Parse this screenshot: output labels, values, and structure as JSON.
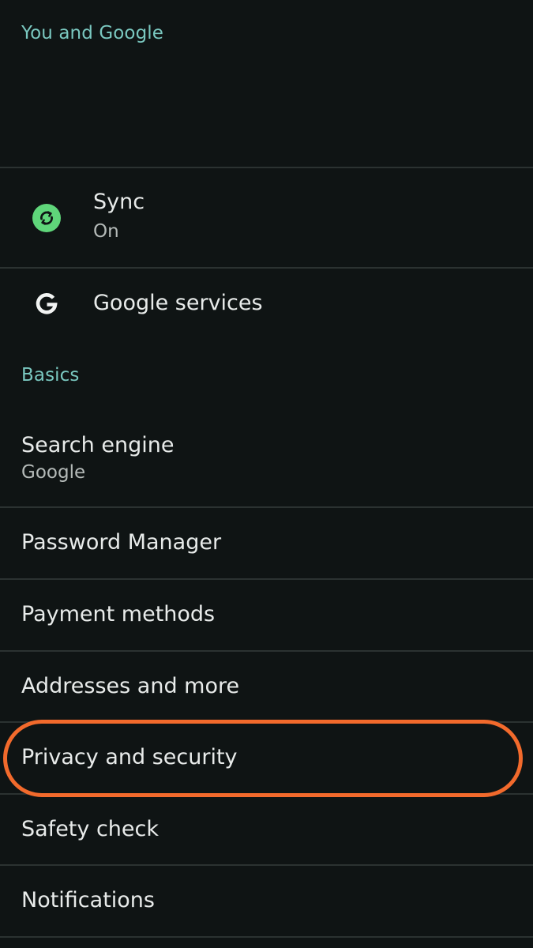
{
  "sections": {
    "you_and_google": "You and Google",
    "basics": "Basics"
  },
  "sync": {
    "title": "Sync",
    "status": "On",
    "icon": "sync-icon",
    "icon_color": "#5fd67a"
  },
  "google_services": {
    "title": "Google services",
    "icon": "google-g-icon"
  },
  "search_engine": {
    "title": "Search engine",
    "value": "Google"
  },
  "items": {
    "password_manager": "Password Manager",
    "payment_methods": "Payment methods",
    "addresses": "Addresses and more",
    "privacy": "Privacy and security",
    "safety_check": "Safety check",
    "notifications": "Notifications"
  },
  "colors": {
    "background": "#0f1414",
    "accent": "#7ac8c0",
    "highlight": "#f26a2c"
  }
}
